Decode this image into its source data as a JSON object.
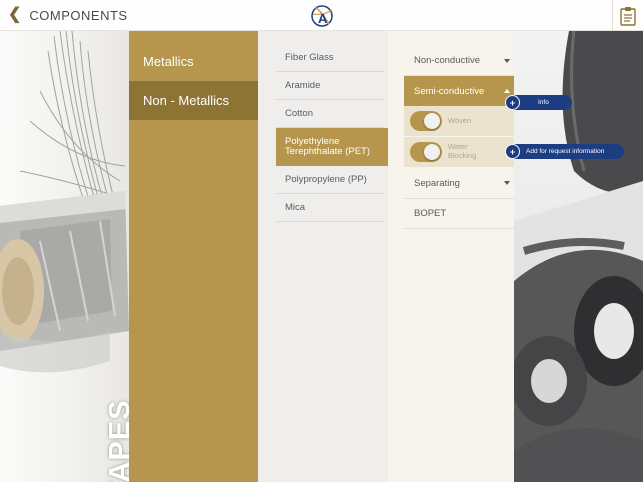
{
  "header": {
    "back_icon": "chevron-left-icon",
    "title": "COMPONENTS",
    "logo_letter": "A",
    "clipboard_icon": "clipboard-icon"
  },
  "banner": {
    "label": "TAPES"
  },
  "categories": [
    {
      "label": "Metallics",
      "selected": false
    },
    {
      "label": "Non - Metallics",
      "selected": true
    }
  ],
  "materials": [
    {
      "label": "Fiber Glass",
      "selected": false
    },
    {
      "label": "Aramide",
      "selected": false
    },
    {
      "label": "Cotton",
      "selected": false
    },
    {
      "label": "Polyethylene Terephthalate (PET)",
      "selected": true
    },
    {
      "label": "Polypropylene (PP)",
      "selected": false
    },
    {
      "label": "Mica",
      "selected": false
    }
  ],
  "types": {
    "non_conductive": "Non-conductive",
    "semi_conductive": "Semi-conductive",
    "sub_items": [
      {
        "label": "Woven",
        "toggle_on": true
      },
      {
        "label": "Water Blocking",
        "toggle_on": true
      }
    ],
    "separating": "Separating",
    "bopet": "BOPET"
  },
  "buttons": {
    "info": "Info",
    "add_request": "Add for request information",
    "plus_icon": "plus-icon"
  },
  "colors": {
    "gold": "#b5964c",
    "gold_dark": "#8e7434",
    "navy": "#1c3d82"
  }
}
